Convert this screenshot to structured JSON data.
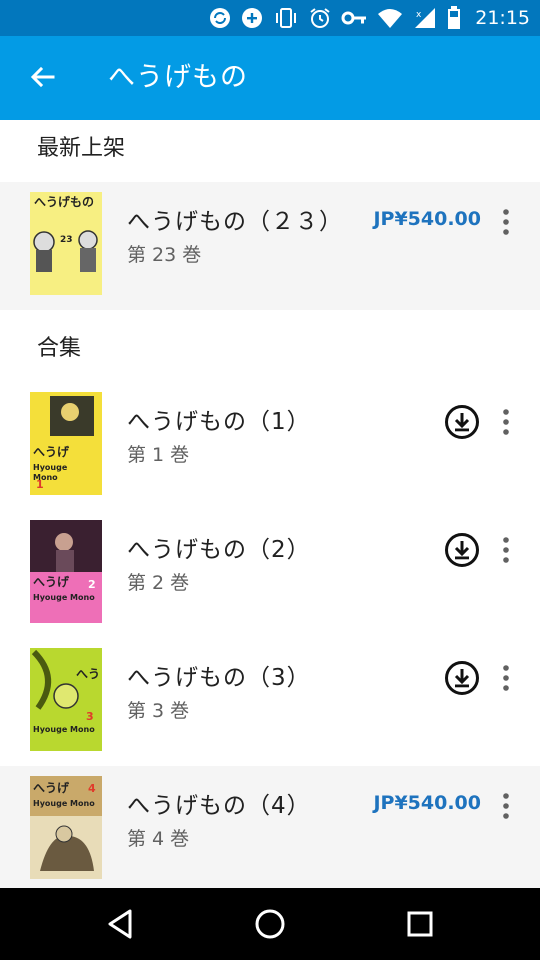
{
  "status_bar": {
    "time": "21:15",
    "icons": [
      "sync-icon",
      "add-circle-icon",
      "vibrate-icon",
      "alarm-icon",
      "vpn-key-icon",
      "wifi-icon",
      "signal-icon",
      "battery-icon"
    ]
  },
  "app_bar": {
    "title": "へうげもの",
    "back_icon": "arrow-back-icon"
  },
  "sections": {
    "latest": {
      "header": "最新上架",
      "items": [
        {
          "title": "へうげもの（２３）",
          "subtitle": "第 23 巻",
          "price": "JP¥540.00",
          "cover_badge": "23"
        }
      ]
    },
    "collection": {
      "header": "合集",
      "items": [
        {
          "title": "へうげもの（1）",
          "subtitle": "第 1 巻",
          "action": "download",
          "cover_color": "#f4df3a"
        },
        {
          "title": "へうげもの（2）",
          "subtitle": "第 2 巻",
          "action": "download",
          "cover_color": "#ee6fb7"
        },
        {
          "title": "へうげもの（3）",
          "subtitle": "第 3 巻",
          "action": "download",
          "cover_color": "#b9d82f"
        },
        {
          "title": "へうげもの（4）",
          "subtitle": "第 4 巻",
          "price": "JP¥540.00",
          "cover_color": "#c9a96a"
        }
      ]
    }
  },
  "colors": {
    "status_bar": "#0277bd",
    "app_bar": "#039be5",
    "price": "#1e73be",
    "shaded_row": "#f5f5f5"
  },
  "nav_bar": {
    "icons": [
      "back-triangle-icon",
      "home-circle-icon",
      "recents-square-icon"
    ]
  }
}
